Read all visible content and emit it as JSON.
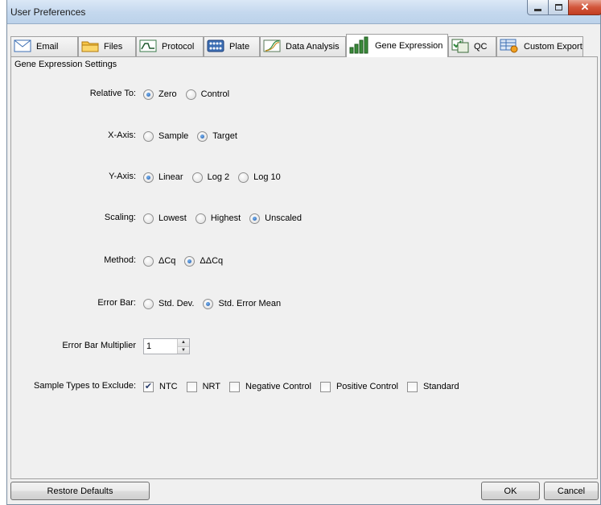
{
  "window": {
    "title": "User Preferences"
  },
  "tabs": [
    {
      "label": "Email",
      "icon": "envelope-icon"
    },
    {
      "label": "Files",
      "icon": "folder-icon"
    },
    {
      "label": "Protocol",
      "icon": "protocol-curve-icon"
    },
    {
      "label": "Plate",
      "icon": "plate-grid-icon"
    },
    {
      "label": "Data Analysis",
      "icon": "data-analysis-icon"
    },
    {
      "label": "Gene Expression",
      "icon": "bar-chart-icon",
      "active": true
    },
    {
      "label": "QC",
      "icon": "qc-checklist-icon"
    },
    {
      "label": "Custom Export",
      "icon": "export-table-icon"
    }
  ],
  "group": {
    "title": "Gene Expression Settings"
  },
  "settings": {
    "relative_to": {
      "label": "Relative To:",
      "options": [
        "Zero",
        "Control"
      ],
      "selected": "Zero"
    },
    "x_axis": {
      "label": "X-Axis:",
      "options": [
        "Sample",
        "Target"
      ],
      "selected": "Target"
    },
    "y_axis": {
      "label": "Y-Axis:",
      "options": [
        "Linear",
        "Log 2",
        "Log 10"
      ],
      "selected": "Linear"
    },
    "scaling": {
      "label": "Scaling:",
      "options": [
        "Lowest",
        "Highest",
        "Unscaled"
      ],
      "selected": "Unscaled"
    },
    "method": {
      "label": "Method:",
      "options": [
        "ΔCq",
        "ΔΔCq"
      ],
      "selected": "ΔΔCq"
    },
    "error_bar": {
      "label": "Error Bar:",
      "options": [
        "Std. Dev.",
        "Std. Error Mean"
      ],
      "selected": "Std. Error Mean"
    },
    "error_bar_multiplier": {
      "label": "Error Bar Multiplier",
      "value": "1"
    },
    "exclude": {
      "label": "Sample Types to Exclude:",
      "options": [
        {
          "label": "NTC",
          "checked": true
        },
        {
          "label": "NRT",
          "checked": false
        },
        {
          "label": "Negative Control",
          "checked": false
        },
        {
          "label": "Positive Control",
          "checked": false
        },
        {
          "label": "Standard",
          "checked": false
        }
      ]
    }
  },
  "buttons": {
    "restore": "Restore Defaults",
    "ok": "OK",
    "cancel": "Cancel"
  },
  "colors": {
    "titlebar": "#c4d8ee",
    "panel": "#f0f0f0",
    "close": "#c23d21",
    "radio_dot": "#1d55a8"
  }
}
